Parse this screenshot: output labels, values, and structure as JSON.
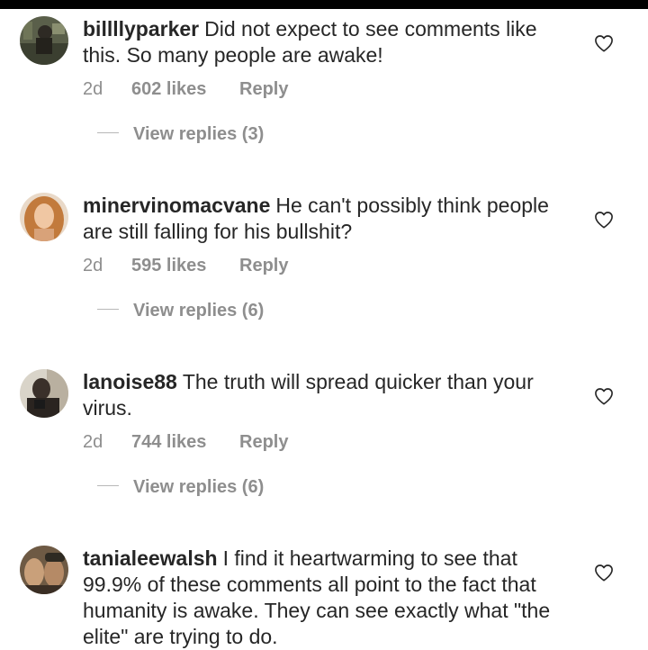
{
  "comments": [
    {
      "username": "billllyparker",
      "text": "Did not expect to see comments like this. So many people are awake!",
      "time": "2d",
      "likes": "602 likes",
      "reply_label": "Reply",
      "view_replies": "View replies (3)",
      "avatar_icon": "profile-photo",
      "like_icon": "heart-outline-icon"
    },
    {
      "username": "minervinomacvane",
      "text": "He can't possibly think people are still falling for his bullshit?",
      "time": "2d",
      "likes": "595 likes",
      "reply_label": "Reply",
      "view_replies": "View replies (6)",
      "avatar_icon": "profile-photo",
      "like_icon": "heart-outline-icon"
    },
    {
      "username": "lanoise88",
      "text": "The truth will spread quicker than your virus.",
      "time": "2d",
      "likes": "744 likes",
      "reply_label": "Reply",
      "view_replies": "View replies (6)",
      "avatar_icon": "profile-photo",
      "like_icon": "heart-outline-icon"
    },
    {
      "username": "tanialeewalsh",
      "text": "I find it heartwarming to see that 99.9% of these comments all point to the fact that humanity is awake.  They can see exactly what \"the elite\" are trying to do.",
      "avatar_icon": "profile-photo",
      "like_icon": "heart-outline-icon"
    }
  ]
}
